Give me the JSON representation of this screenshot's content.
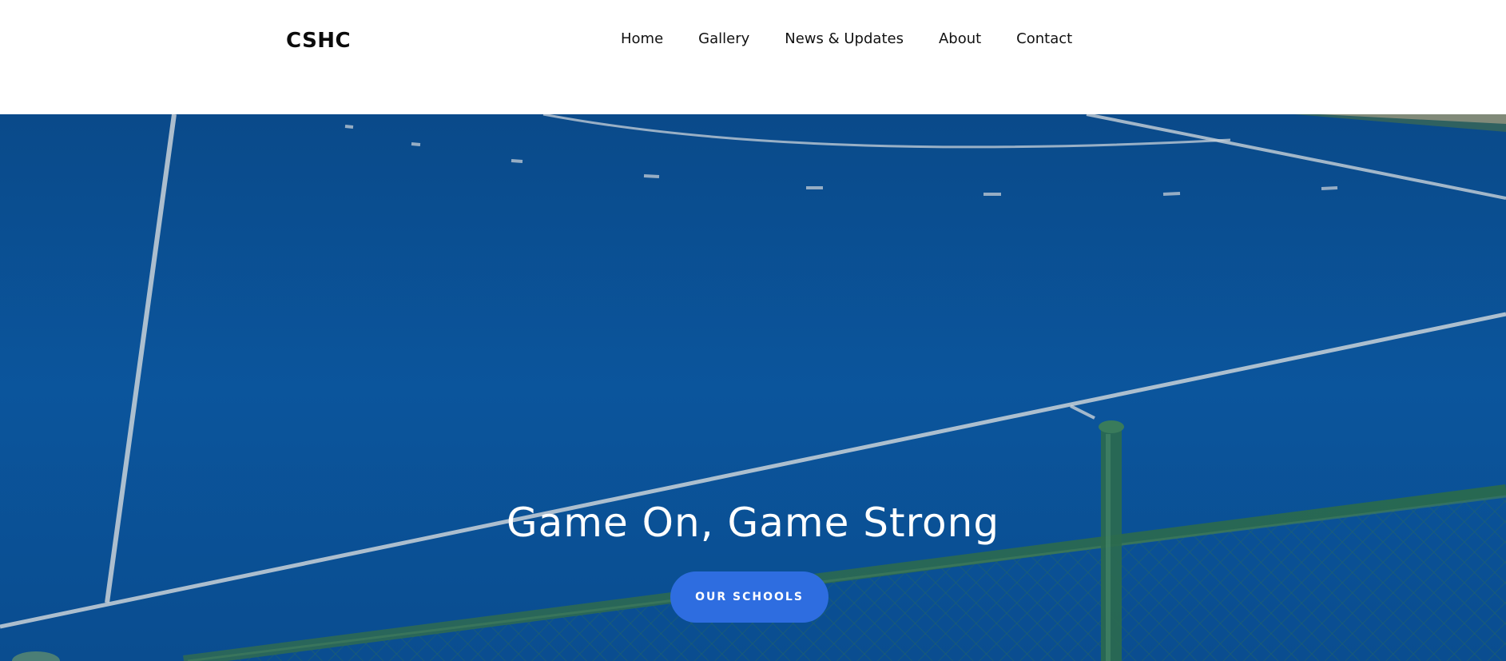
{
  "header": {
    "brand": "CSHC",
    "nav": [
      {
        "label": "Home"
      },
      {
        "label": "Gallery"
      },
      {
        "label": "News & Updates"
      },
      {
        "label": "About"
      },
      {
        "label": "Contact"
      }
    ]
  },
  "hero": {
    "title": "Game On, Game Strong",
    "cta_label": "OUR SCHOOLS",
    "background": "hockey-pitch-photo"
  },
  "colors": {
    "pitch_blue": "#0a4f92",
    "cta_blue": "#2e6de0",
    "fence_green": "#2e6b4e",
    "line_white": "#d9dfe6"
  }
}
